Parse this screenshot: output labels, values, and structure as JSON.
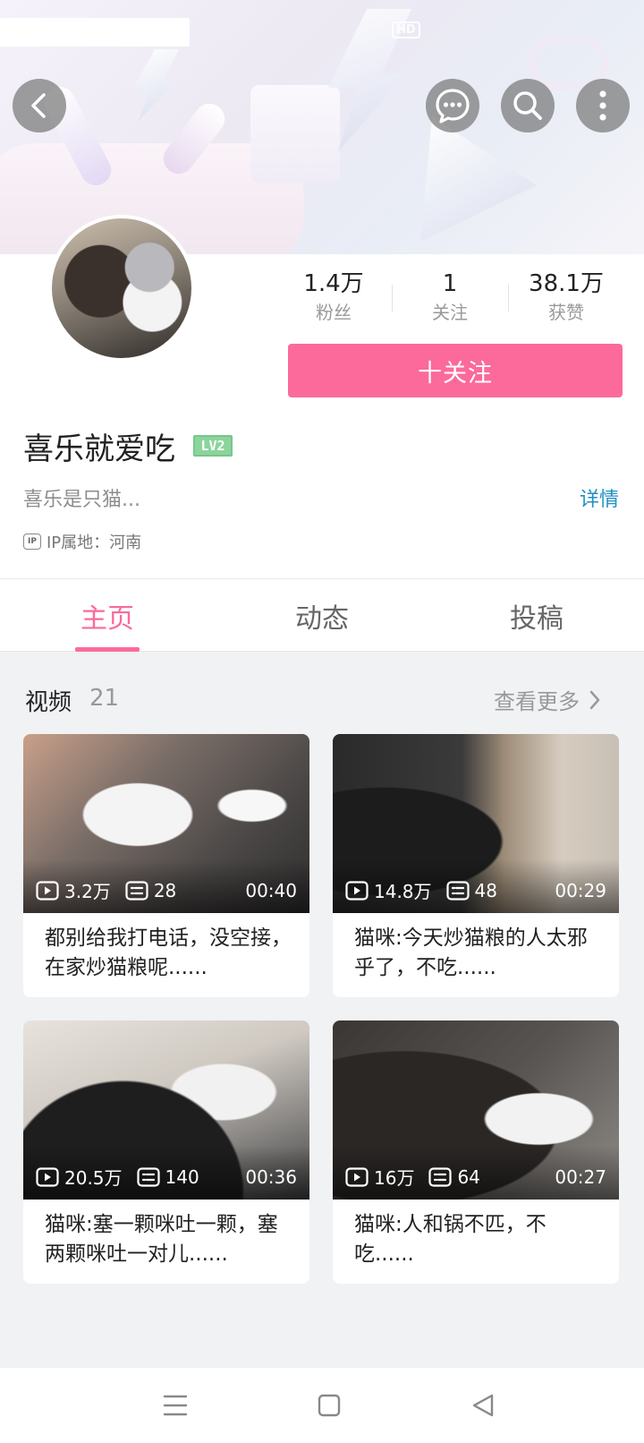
{
  "status": {
    "hd": "HD"
  },
  "header": {
    "back_icon": "chevron-left-icon",
    "message_icon": "chat-bubble-icon",
    "search_icon": "search-icon",
    "more_icon": "more-vertical-icon"
  },
  "profile": {
    "name": "喜乐就爱吃",
    "level": "LV2",
    "bio": "喜乐是只猫...",
    "detail_link": "详情",
    "ip_label": "IP属地：河南",
    "stats": [
      {
        "value": "1.4万",
        "label": "粉丝"
      },
      {
        "value": "1",
        "label": "关注"
      },
      {
        "value": "38.1万",
        "label": "获赞"
      }
    ],
    "follow_button": "十关注"
  },
  "tabs": [
    {
      "label": "主页",
      "active": true
    },
    {
      "label": "动态",
      "active": false
    },
    {
      "label": "投稿",
      "active": false
    }
  ],
  "videos_section": {
    "title": "视频",
    "count": "21",
    "more": "查看更多",
    "items": [
      {
        "views": "3.2万",
        "comments": "28",
        "duration": "00:40",
        "caption": "都别给我打电话，没空接，在家炒猫粮呢......"
      },
      {
        "views": "14.8万",
        "comments": "48",
        "duration": "00:29",
        "caption": "猫咪:今天炒猫粮的人太邪乎了，不吃......"
      },
      {
        "views": "20.5万",
        "comments": "140",
        "duration": "00:36",
        "caption": "猫咪:塞一颗咪吐一颗，塞两颗咪吐一对儿......"
      },
      {
        "views": "16万",
        "comments": "64",
        "duration": "00:27",
        "caption": "猫咪:人和锅不匹，不吃......"
      }
    ]
  },
  "colors": {
    "accent": "#fb6a9b",
    "link": "#1f8fc4",
    "level": "#8bd59c"
  }
}
